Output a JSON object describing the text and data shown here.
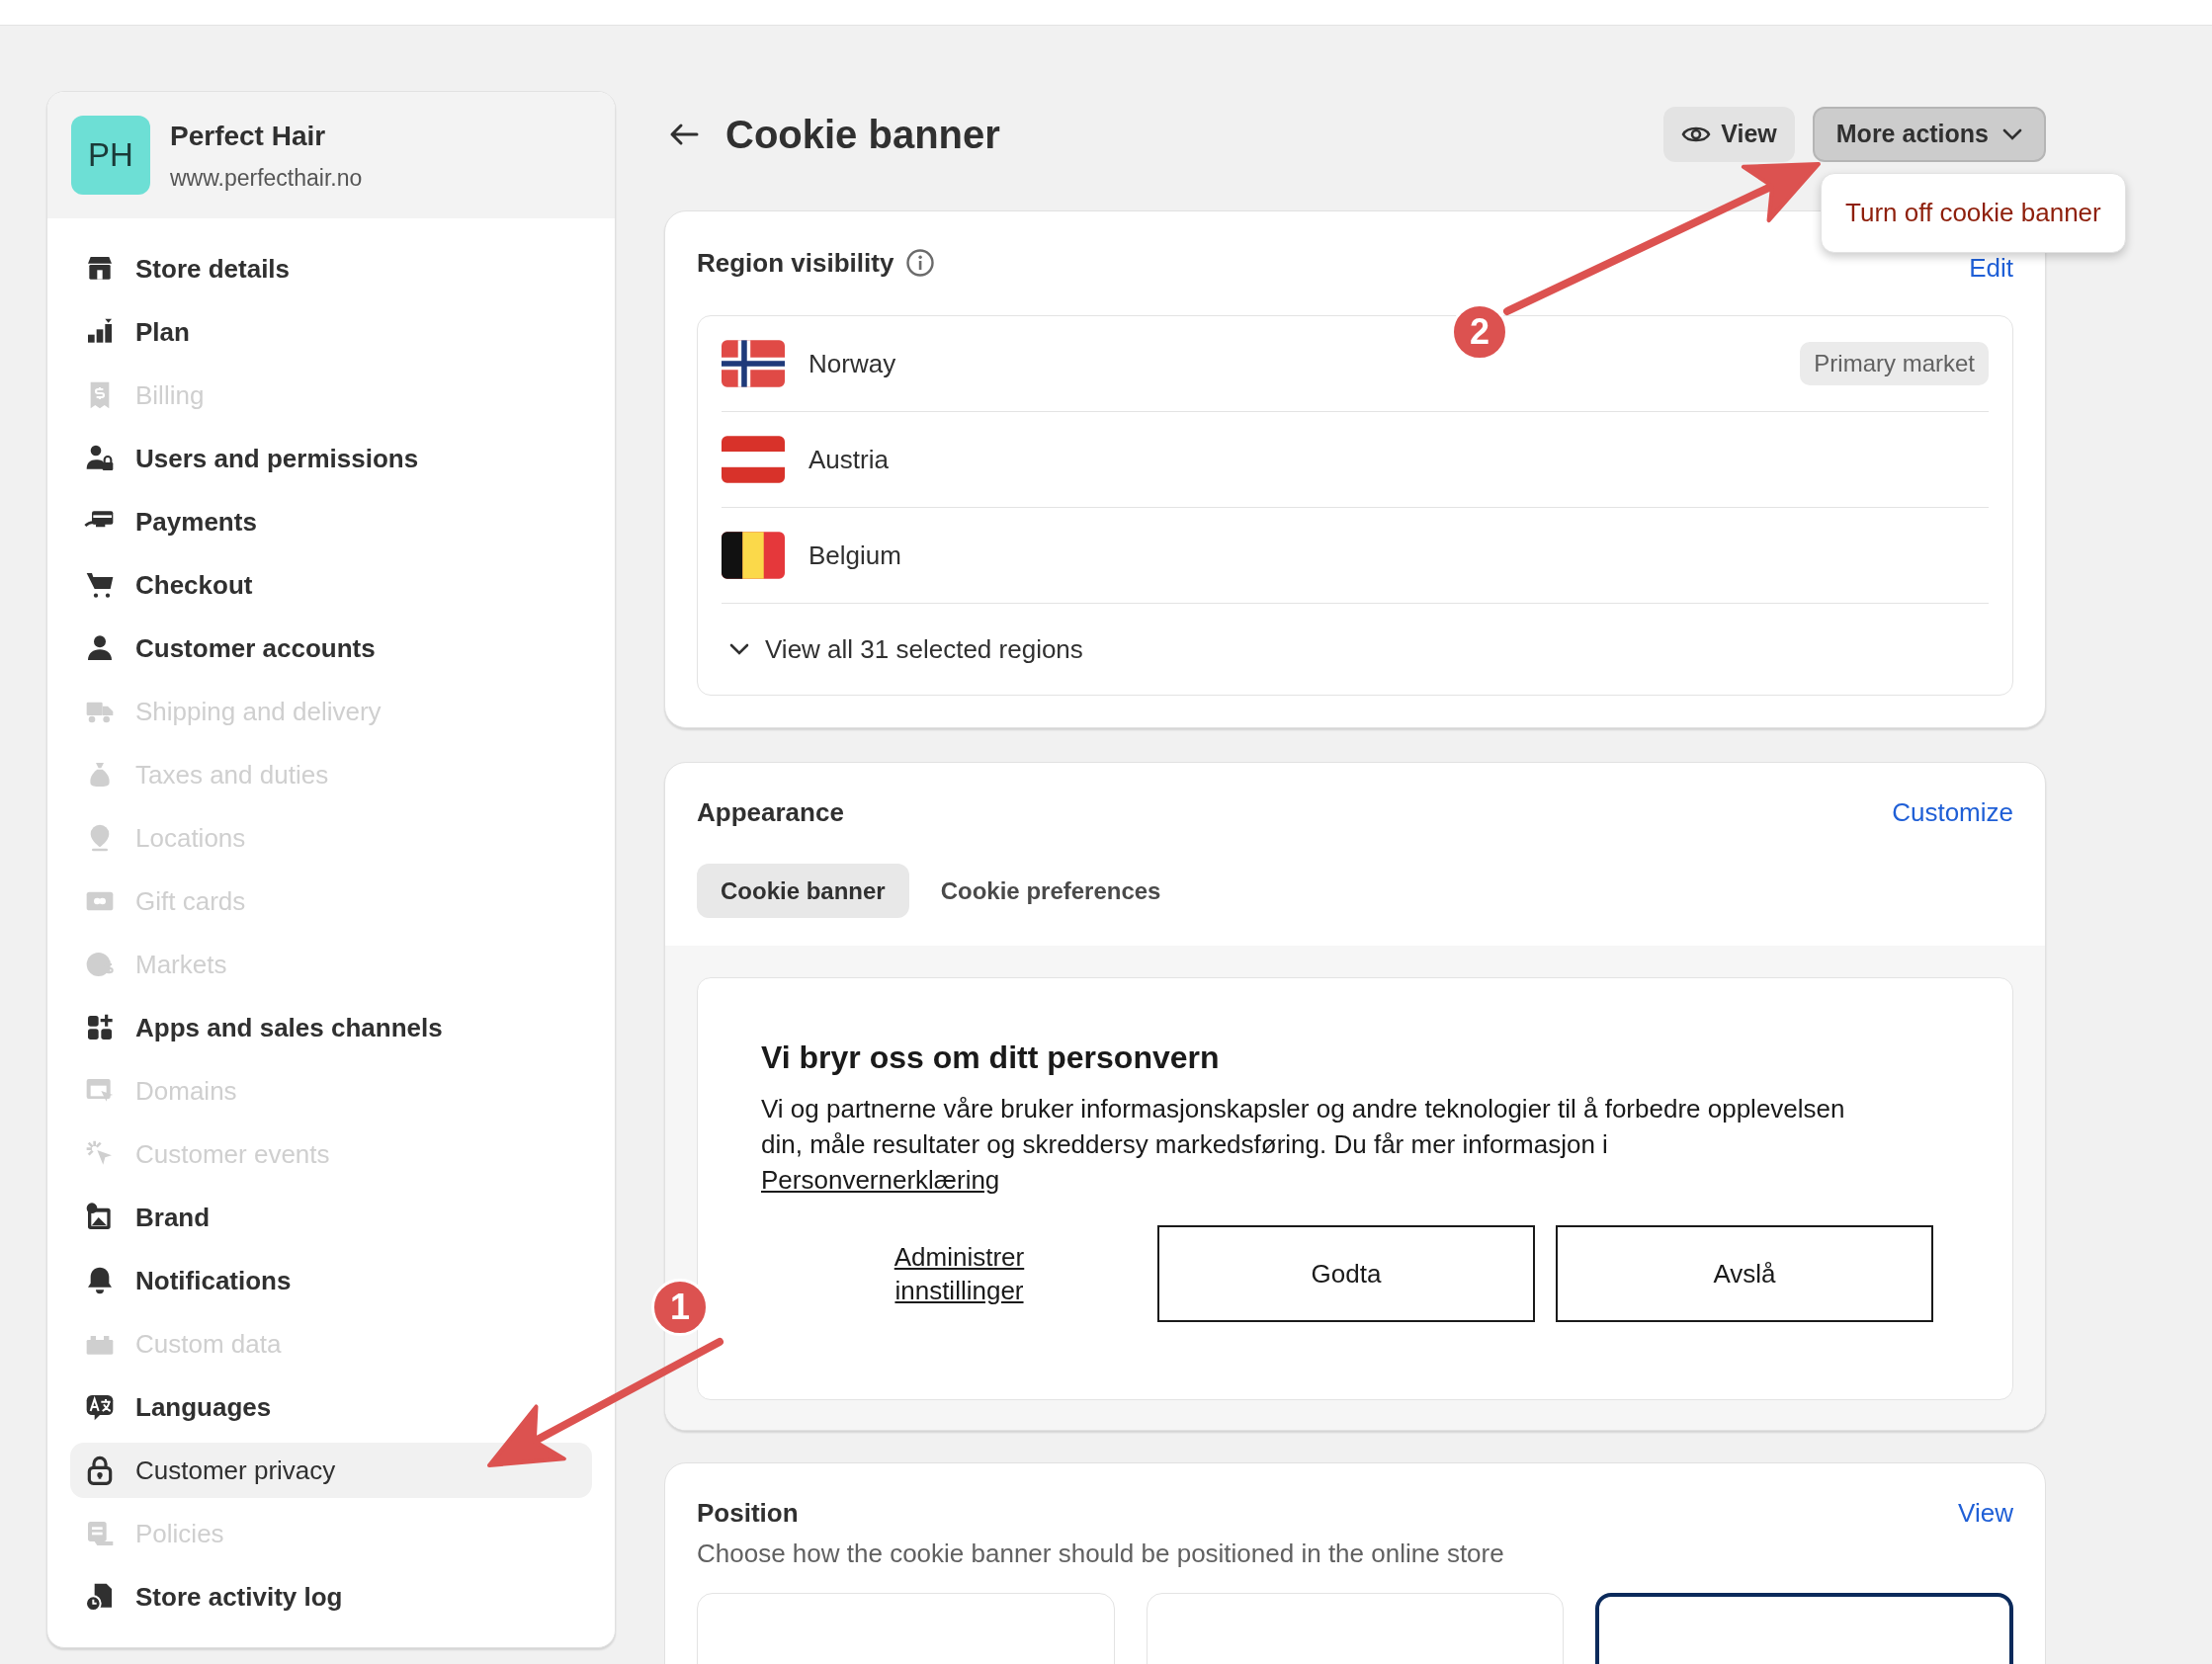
{
  "store": {
    "initials": "PH",
    "name": "Perfect Hair",
    "url": "www.perfecthair.no"
  },
  "sidebar": {
    "items": [
      {
        "label": "Store details",
        "disabled": false,
        "selected": false
      },
      {
        "label": "Plan",
        "disabled": false,
        "selected": false
      },
      {
        "label": "Billing",
        "disabled": true,
        "selected": false
      },
      {
        "label": "Users and permissions",
        "disabled": false,
        "selected": false
      },
      {
        "label": "Payments",
        "disabled": false,
        "selected": false
      },
      {
        "label": "Checkout",
        "disabled": false,
        "selected": false
      },
      {
        "label": "Customer accounts",
        "disabled": false,
        "selected": false
      },
      {
        "label": "Shipping and delivery",
        "disabled": true,
        "selected": false
      },
      {
        "label": "Taxes and duties",
        "disabled": true,
        "selected": false
      },
      {
        "label": "Locations",
        "disabled": true,
        "selected": false
      },
      {
        "label": "Gift cards",
        "disabled": true,
        "selected": false
      },
      {
        "label": "Markets",
        "disabled": true,
        "selected": false
      },
      {
        "label": "Apps and sales channels",
        "disabled": false,
        "selected": false
      },
      {
        "label": "Domains",
        "disabled": true,
        "selected": false
      },
      {
        "label": "Customer events",
        "disabled": true,
        "selected": false
      },
      {
        "label": "Brand",
        "disabled": false,
        "selected": false
      },
      {
        "label": "Notifications",
        "disabled": false,
        "selected": false
      },
      {
        "label": "Custom data",
        "disabled": true,
        "selected": false
      },
      {
        "label": "Languages",
        "disabled": false,
        "selected": false
      },
      {
        "label": "Customer privacy",
        "disabled": false,
        "selected": true
      },
      {
        "label": "Policies",
        "disabled": true,
        "selected": false
      },
      {
        "label": "Store activity log",
        "disabled": false,
        "selected": false
      }
    ]
  },
  "page": {
    "title": "Cookie banner",
    "view_button": "View",
    "more_actions_button": "More actions"
  },
  "dropdown": {
    "items": [
      "Turn off cookie banner"
    ]
  },
  "region_visibility": {
    "title": "Region visibility",
    "edit_link": "Edit",
    "regions": [
      {
        "name": "Norway",
        "badge": "Primary market"
      },
      {
        "name": "Austria"
      },
      {
        "name": "Belgium"
      }
    ],
    "view_all": "View all 31 selected regions"
  },
  "appearance": {
    "title": "Appearance",
    "customize_link": "Customize",
    "tabs": [
      {
        "label": "Cookie banner",
        "selected": true
      },
      {
        "label": "Cookie preferences",
        "selected": false
      }
    ],
    "preview": {
      "heading": "Vi bryr oss om ditt personvern",
      "text": "Vi og partnerne våre bruker informasjonskapsler og andre teknologier til å forbedre opplevelsen din, måle resultater og skreddersy markedsføring. Du får mer informasjon i",
      "policy_link": "Personvernerklæring",
      "manage_link": "Administrer innstillinger",
      "buttons": [
        "Godta",
        "Avslå"
      ]
    }
  },
  "position": {
    "title": "Position",
    "view_link": "View",
    "description": "Choose how the cookie banner should be positioned in the online store",
    "options": [
      {
        "selected": false
      },
      {
        "selected": false
      },
      {
        "selected": true
      }
    ]
  },
  "annotations": [
    {
      "label": "1"
    },
    {
      "label": "2"
    }
  ]
}
